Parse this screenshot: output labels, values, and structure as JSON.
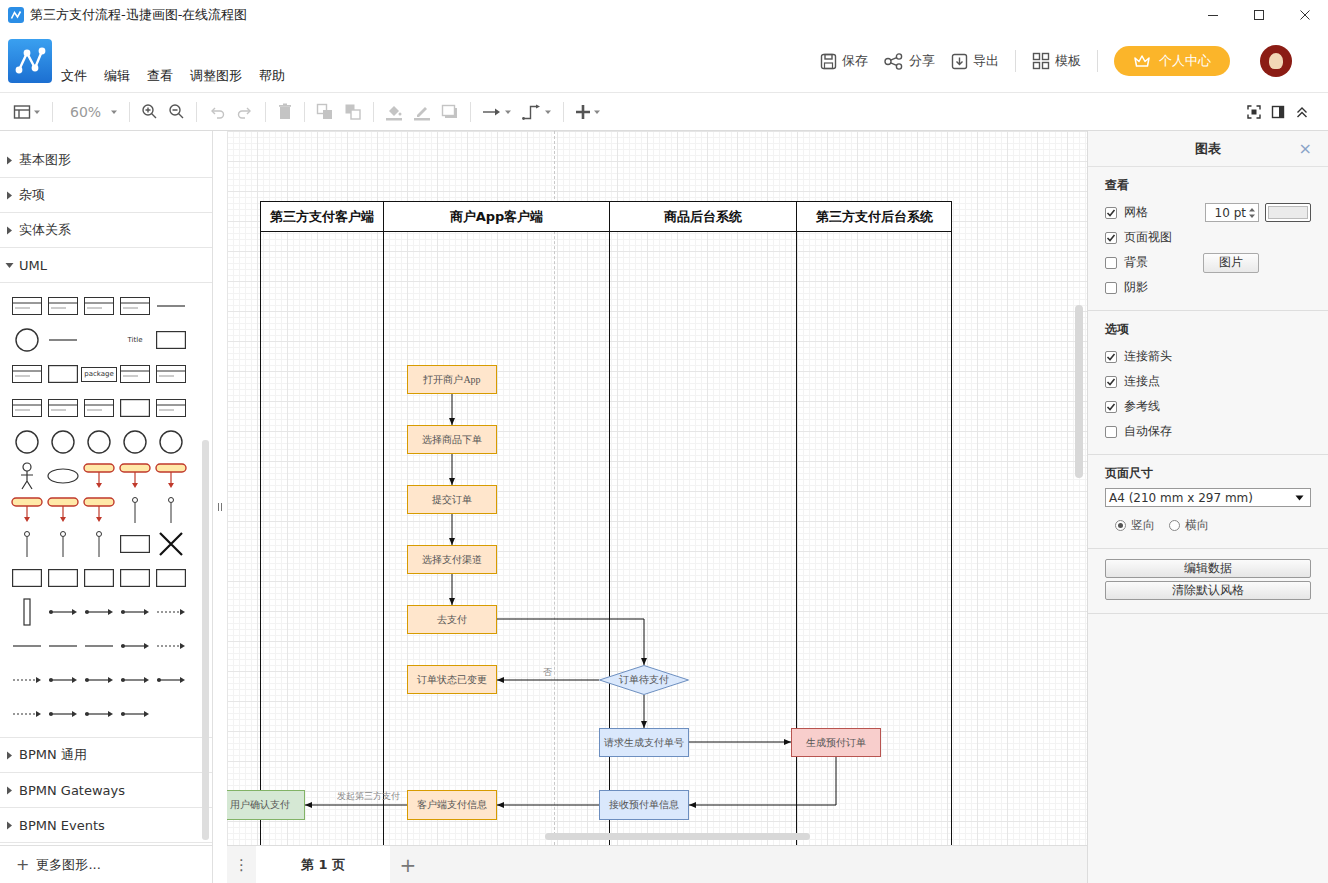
{
  "window": {
    "title": "第三方支付流程-迅捷画图-在线流程图"
  },
  "menu": [
    {
      "label": "文件"
    },
    {
      "label": "编辑"
    },
    {
      "label": "查看"
    },
    {
      "label": "调整图形"
    },
    {
      "label": "帮助"
    }
  ],
  "header_actions": [
    {
      "label": "保存",
      "kind": "save"
    },
    {
      "label": "分享",
      "kind": "share"
    },
    {
      "label": "导出",
      "kind": "export"
    },
    {
      "label": "模板",
      "kind": "template"
    }
  ],
  "personal_center": "个人中心",
  "toolbar": {
    "groups": [
      [
        {
          "kind": "layout",
          "disabled": false
        }
      ],
      [
        {
          "kind": "zoom",
          "label": "60%",
          "disabled": false
        }
      ],
      [
        {
          "kind": "zoomin",
          "disabled": false
        },
        {
          "kind": "zoomout",
          "disabled": false
        }
      ],
      [
        {
          "kind": "undo",
          "disabled": true
        },
        {
          "kind": "redo",
          "disabled": true
        }
      ],
      [
        {
          "kind": "delete",
          "disabled": true
        }
      ],
      [
        {
          "kind": "tofront",
          "disabled": true
        },
        {
          "kind": "toback",
          "disabled": true
        }
      ],
      [
        {
          "kind": "fill",
          "disabled": true
        },
        {
          "kind": "line",
          "disabled": true
        },
        {
          "kind": "shadow",
          "disabled": true
        }
      ],
      [
        {
          "kind": "connection",
          "disabled": false
        },
        {
          "kind": "waypoint",
          "disabled": false
        }
      ],
      [
        {
          "kind": "insert",
          "disabled": false
        }
      ]
    ],
    "right": [
      {
        "kind": "fit",
        "disabled": false
      },
      {
        "kind": "format",
        "disabled": false
      },
      {
        "kind": "collapse",
        "disabled": false
      }
    ]
  },
  "sidebar": {
    "groups": [
      {
        "label": "基本图形",
        "expanded": false
      },
      {
        "label": "杂项",
        "expanded": false
      },
      {
        "label": "实体关系",
        "expanded": false
      },
      {
        "label": "UML",
        "expanded": true
      },
      {
        "label": "BPMN 通用",
        "expanded": false
      },
      {
        "label": "BPMN Gateways",
        "expanded": false
      },
      {
        "label": "BPMN Events",
        "expanded": false
      }
    ],
    "shape_labels": [
      "Title",
      "package"
    ],
    "more_icon": "+",
    "more": "更多图形..."
  },
  "diagram": {
    "lanes": [
      {
        "title": "第三方支付客户端"
      },
      {
        "title": "商户App客户端"
      },
      {
        "title": "商品后台系统"
      },
      {
        "title": "第三方支付后台系统"
      }
    ],
    "nodes": [
      {
        "text": "打开商户App",
        "kind": "process",
        "color": "#ffe6cc"
      },
      {
        "text": "选择商品下单",
        "kind": "process",
        "color": "#ffe6cc"
      },
      {
        "text": "提交订单",
        "kind": "process",
        "color": "#ffe6cc"
      },
      {
        "text": "选择支付渠道",
        "kind": "process",
        "color": "#ffe6cc"
      },
      {
        "text": "去支付",
        "kind": "process",
        "color": "#ffe6cc"
      },
      {
        "text": "订单状态已变更",
        "kind": "process",
        "color": "#ffe6cc"
      },
      {
        "text": "订单待支付",
        "kind": "decision",
        "color": "#dae8fc"
      },
      {
        "text": "请求生成支付单号",
        "kind": "process",
        "color": "#dae8fc"
      },
      {
        "text": "生成预付订单",
        "kind": "process",
        "color": "#f8cecc"
      },
      {
        "text": "接收预付单信息",
        "kind": "process",
        "color": "#dae8fc"
      },
      {
        "text": "客户端支付信息",
        "kind": "process",
        "color": "#ffe6cc"
      },
      {
        "text": "用户确认支付",
        "kind": "process",
        "color": "#d5e8d4"
      }
    ],
    "edge_labels": [
      "否",
      "发起第三方支付"
    ]
  },
  "pages": {
    "menu": "⋮",
    "tabs": [
      {
        "label": "第 1 页",
        "selected": true
      }
    ],
    "add": "+"
  },
  "panel": {
    "title": "图表",
    "close": "×",
    "view": {
      "heading": "查看",
      "items": [
        {
          "label": "网格",
          "checked": true,
          "kind": "grid"
        },
        {
          "label": "页面视图",
          "checked": true,
          "kind": "plain"
        },
        {
          "label": "背景",
          "checked": false,
          "kind": "image"
        },
        {
          "label": "阴影",
          "checked": false,
          "kind": "plain"
        }
      ],
      "grid_size": "10 pt",
      "image_button": "图片"
    },
    "options": {
      "heading": "选项",
      "items": [
        {
          "label": "连接箭头",
          "checked": true
        },
        {
          "label": "连接点",
          "checked": true
        },
        {
          "label": "参考线",
          "checked": true
        },
        {
          "label": "自动保存",
          "checked": false
        }
      ]
    },
    "page_size": {
      "heading": "页面尺寸",
      "value": "A4 (210 mm x 297 mm)",
      "orientations": [
        {
          "label": "竖向",
          "selected": true
        },
        {
          "label": "横向",
          "selected": false
        }
      ]
    },
    "buttons": [
      {
        "label": "编辑数据"
      },
      {
        "label": "清除默认风格"
      }
    ]
  }
}
